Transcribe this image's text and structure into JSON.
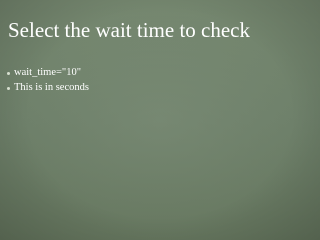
{
  "slide": {
    "title": "Select the wait time to check",
    "bullets": [
      "wait_time=\"10\"",
      "This is in seconds"
    ]
  },
  "colors": {
    "background": "#6f806b",
    "text": "#ffffff",
    "bullet": "#d7dfcf"
  },
  "icons": {
    "bullet": "bullet-icon"
  }
}
